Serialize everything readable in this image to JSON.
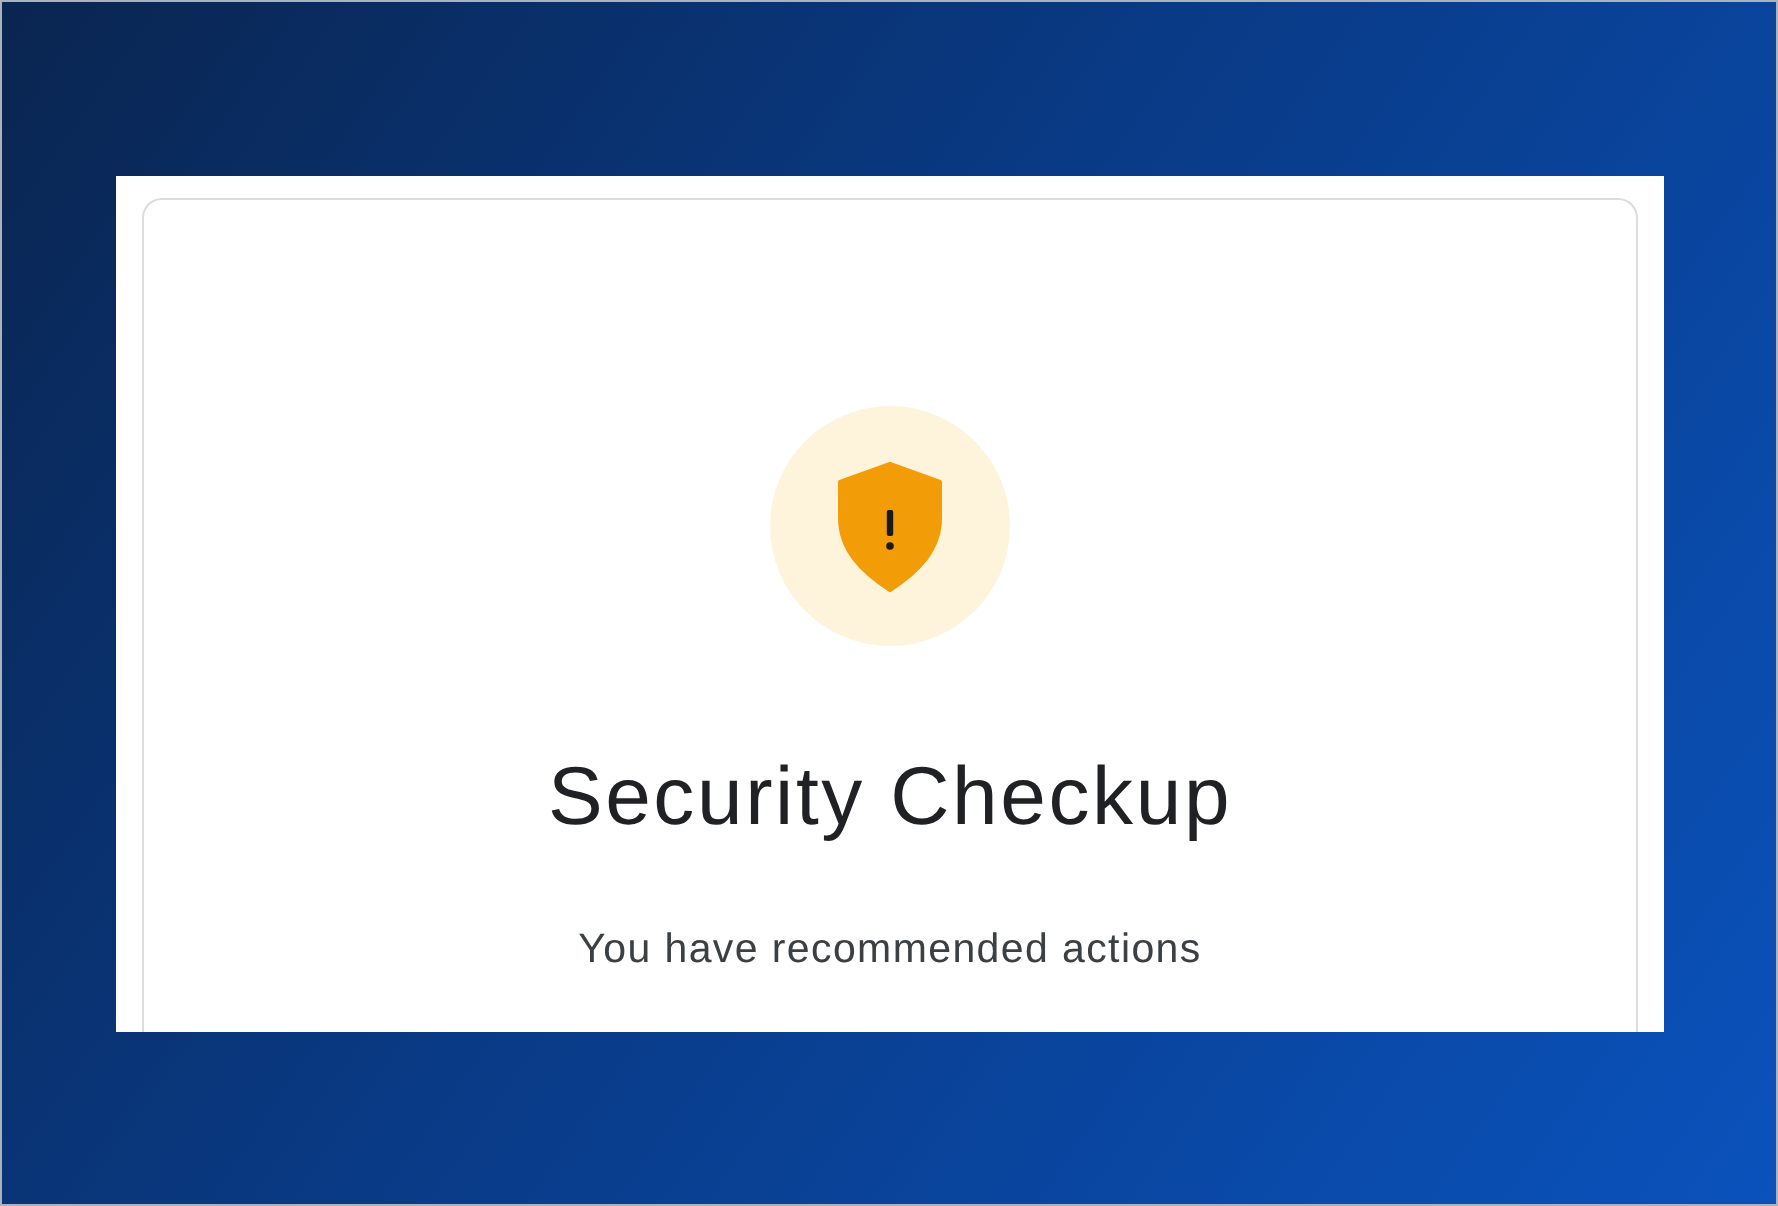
{
  "card": {
    "title": "Security Checkup",
    "subtitle": "You have recommended actions"
  }
}
